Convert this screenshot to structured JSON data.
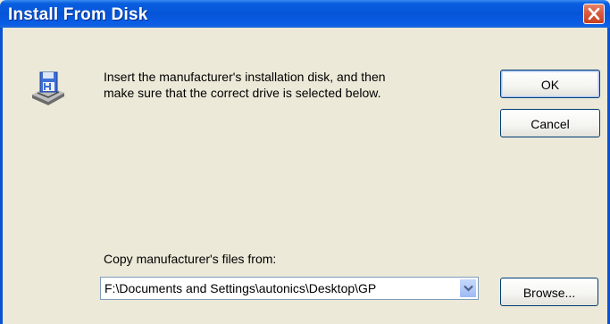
{
  "window": {
    "title": "Install From Disk",
    "close_icon": "close-icon"
  },
  "message": {
    "line1": "Insert the manufacturer's installation disk, and then",
    "line2": "make sure that the correct drive is selected below.",
    "icon": "floppy-disk-drive-icon"
  },
  "buttons": {
    "ok": "OK",
    "cancel": "Cancel",
    "browse": "Browse..."
  },
  "copy_from": {
    "label": "Copy manufacturer's files from:",
    "value": "F:\\Documents and Settings\\autonics\\Desktop\\GP",
    "dropdown_icon": "chevron-down-icon"
  },
  "colors": {
    "titlebar": "#0554d8",
    "dialog_bg": "#ece9d8",
    "close_button": "#d95a3d"
  }
}
